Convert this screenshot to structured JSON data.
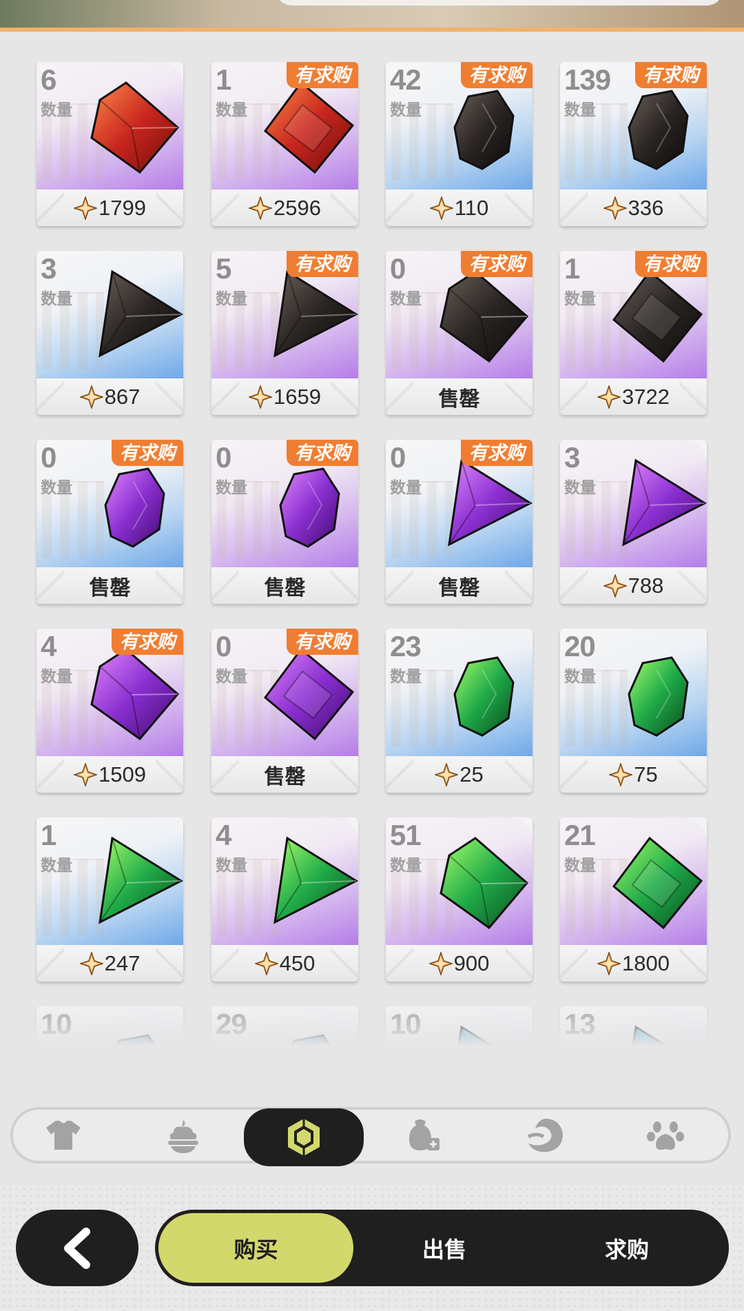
{
  "grid": {
    "quantity_label": "数量",
    "request_badge": "有求购",
    "sold_out_label": "售罄",
    "items": [
      {
        "qty": "6",
        "price": "1799",
        "badge": false,
        "sold_out": false,
        "bg": "purple",
        "gem": "red-octahedron"
      },
      {
        "qty": "1",
        "price": "2596",
        "badge": true,
        "sold_out": false,
        "bg": "purple",
        "gem": "red-square"
      },
      {
        "qty": "42",
        "price": "110",
        "badge": true,
        "sold_out": false,
        "bg": "blue",
        "gem": "black-rough"
      },
      {
        "qty": "139",
        "price": "336",
        "badge": true,
        "sold_out": false,
        "bg": "blue",
        "gem": "black-rough"
      },
      {
        "qty": "3",
        "price": "867",
        "badge": false,
        "sold_out": false,
        "bg": "blue",
        "gem": "black-triangle"
      },
      {
        "qty": "5",
        "price": "1659",
        "badge": true,
        "sold_out": false,
        "bg": "purple",
        "gem": "black-triangle"
      },
      {
        "qty": "0",
        "price": "",
        "badge": true,
        "sold_out": true,
        "bg": "purple",
        "gem": "black-octahedron"
      },
      {
        "qty": "1",
        "price": "3722",
        "badge": true,
        "sold_out": false,
        "bg": "purple",
        "gem": "black-square"
      },
      {
        "qty": "0",
        "price": "",
        "badge": true,
        "sold_out": true,
        "bg": "blue",
        "gem": "purple-rough"
      },
      {
        "qty": "0",
        "price": "",
        "badge": true,
        "sold_out": true,
        "bg": "purple",
        "gem": "purple-rough"
      },
      {
        "qty": "0",
        "price": "",
        "badge": true,
        "sold_out": true,
        "bg": "blue",
        "gem": "purple-triangle"
      },
      {
        "qty": "3",
        "price": "788",
        "badge": false,
        "sold_out": false,
        "bg": "purple",
        "gem": "purple-triangle"
      },
      {
        "qty": "4",
        "price": "1509",
        "badge": true,
        "sold_out": false,
        "bg": "purple",
        "gem": "purple-octahedron"
      },
      {
        "qty": "0",
        "price": "",
        "badge": true,
        "sold_out": true,
        "bg": "purple",
        "gem": "purple-square"
      },
      {
        "qty": "23",
        "price": "25",
        "badge": false,
        "sold_out": false,
        "bg": "blue",
        "gem": "green-rough"
      },
      {
        "qty": "20",
        "price": "75",
        "badge": false,
        "sold_out": false,
        "bg": "blue",
        "gem": "green-rough"
      },
      {
        "qty": "1",
        "price": "247",
        "badge": false,
        "sold_out": false,
        "bg": "blue",
        "gem": "green-triangle"
      },
      {
        "qty": "4",
        "price": "450",
        "badge": false,
        "sold_out": false,
        "bg": "purple",
        "gem": "green-triangle"
      },
      {
        "qty": "51",
        "price": "900",
        "badge": false,
        "sold_out": false,
        "bg": "purple",
        "gem": "green-octahedron"
      },
      {
        "qty": "21",
        "price": "1800",
        "badge": false,
        "sold_out": false,
        "bg": "purple",
        "gem": "green-square"
      },
      {
        "qty": "10",
        "price": "",
        "badge": false,
        "sold_out": false,
        "bg": "blue",
        "gem": "blue-rough"
      },
      {
        "qty": "29",
        "price": "",
        "badge": false,
        "sold_out": false,
        "bg": "blue",
        "gem": "blue-rough"
      },
      {
        "qty": "10",
        "price": "",
        "badge": false,
        "sold_out": false,
        "bg": "blue",
        "gem": "blue-triangle"
      },
      {
        "qty": "13",
        "price": "",
        "badge": false,
        "sold_out": false,
        "bg": "blue",
        "gem": "blue-triangle"
      }
    ]
  },
  "categories": [
    {
      "icon": "shirt-icon"
    },
    {
      "icon": "food-icon"
    },
    {
      "icon": "gem-category-icon",
      "active": true
    },
    {
      "icon": "bag-icon"
    },
    {
      "icon": "wave-icon"
    },
    {
      "icon": "paw-icon"
    }
  ],
  "nav": {
    "back_icon": "back-arrow-icon",
    "buy_label": "购买",
    "sell_label": "出售",
    "request_label": "求购"
  },
  "colors": {
    "badge": "#f07e32",
    "active_tab": "#d3d86c",
    "nav_dark": "#1f1f1f",
    "gem_red": "#c8261e",
    "gem_black": "#2a2523",
    "gem_purple": "#8a2fd0",
    "gem_green": "#1faa48",
    "gem_blue": "#1f57c8"
  }
}
